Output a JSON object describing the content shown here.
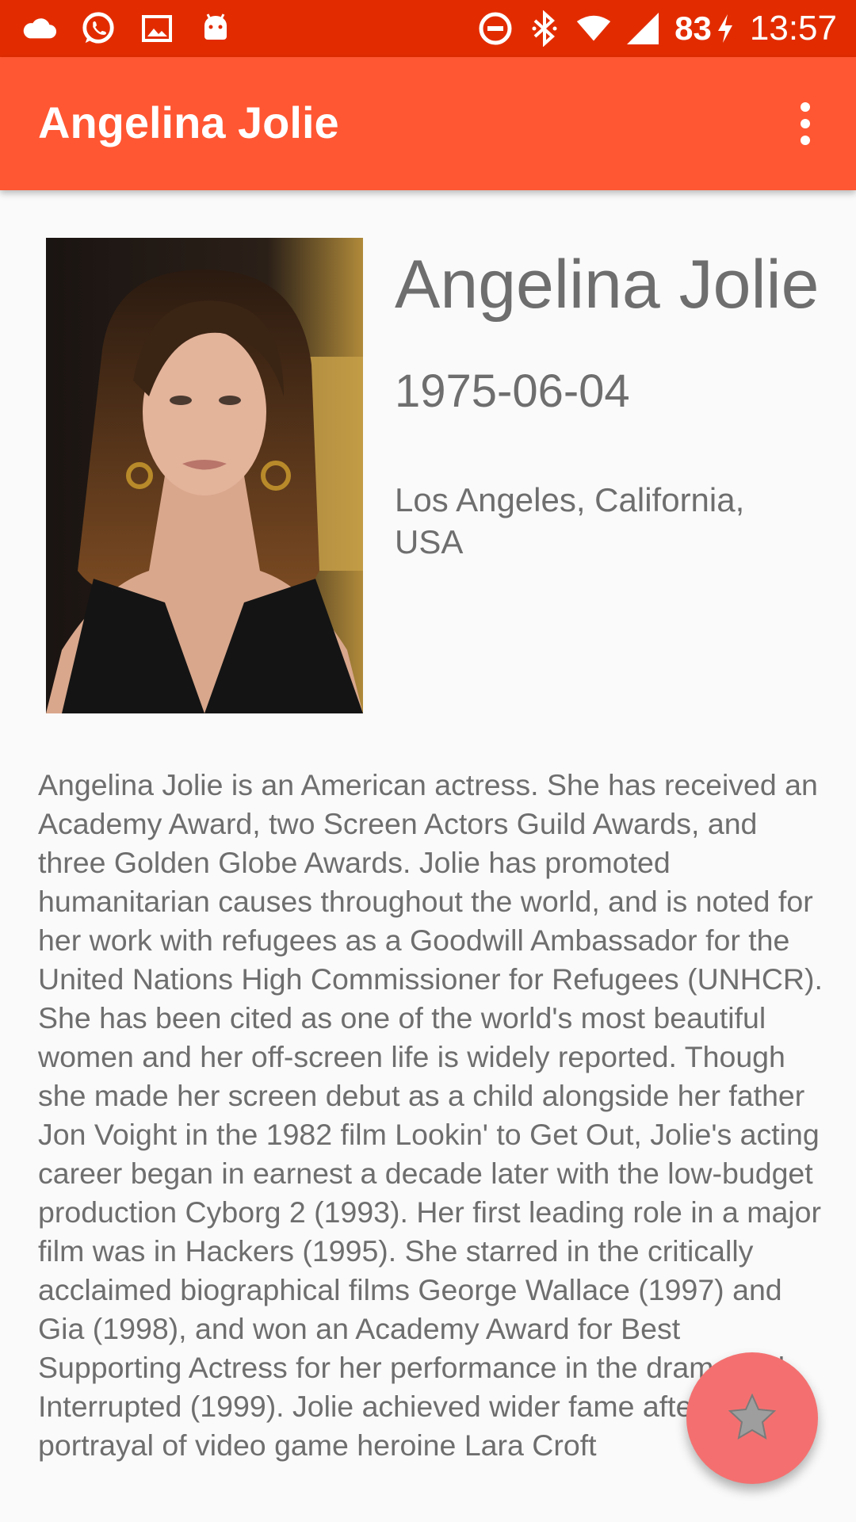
{
  "status_bar": {
    "battery_percent": "83",
    "time": "13:57",
    "left_icons": [
      "cloud-icon",
      "whatsapp-icon",
      "image-icon",
      "android-icon"
    ],
    "right_icons": [
      "dnd-icon",
      "bluetooth-icon",
      "wifi-icon",
      "signal-icon",
      "charging-icon"
    ]
  },
  "appbar": {
    "title": "Angelina Jolie",
    "menu_icon": "overflow-menu-icon"
  },
  "profile": {
    "name": "Angelina Jolie",
    "birthdate": "1975-06-04",
    "birthplace": "Los Angeles, California, USA",
    "biography": "Angelina Jolie is an American actress. She has received an Academy Award, two Screen Actors Guild Awards, and three Golden Globe Awards. Jolie has promoted humanitarian causes throughout the world, and is noted for her work with refugees as a Goodwill Ambassador for the United Nations High Commissioner for Refugees (UNHCR). She has been cited as one of the world's most beautiful women and her off-screen life is widely reported. Though she made her screen debut as a child alongside her father Jon Voight in the 1982 film Lookin' to Get Out, Jolie's acting career began in earnest a decade later with the low-budget production Cyborg 2 (1993). Her first leading role in a major film was in Hackers (1995). She starred in the critically acclaimed biographical films George Wallace (1997) and Gia (1998), and won an Academy Award for Best Supporting Actress for her performance in the drama Girl, Interrupted (1999). Jolie achieved wider fame after her portrayal of video game heroine Lara Croft"
  },
  "fab": {
    "icon": "star-icon"
  },
  "colors": {
    "status_bar": "#e22c00",
    "app_bar": "#ff5733",
    "fab": "#f47070",
    "text": "#6e6e6e",
    "background": "#fafafa"
  }
}
